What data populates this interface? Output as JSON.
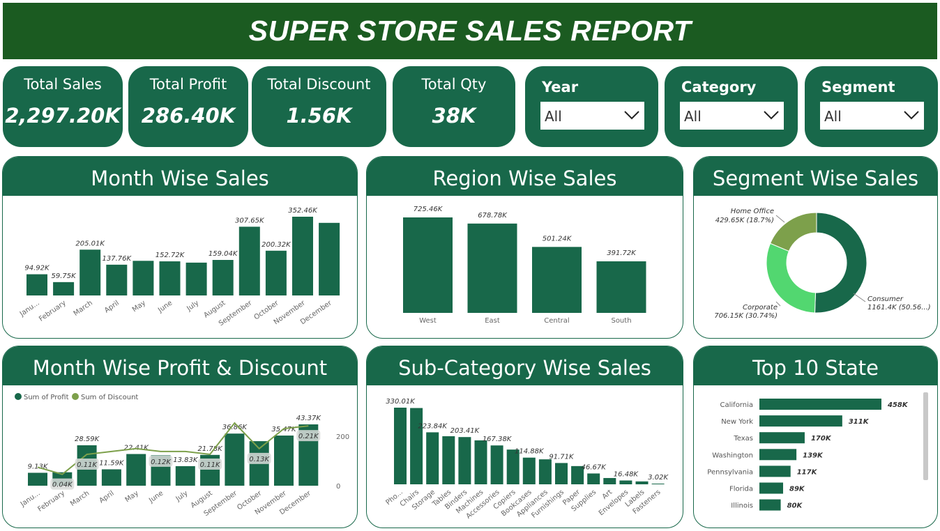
{
  "title": "SUPER STORE SALES REPORT",
  "colors": {
    "dark_green": "#1b5b21",
    "panel_green": "#18684a",
    "bar": "#18684a",
    "light_green": "#52d770",
    "olive": "#7da04b"
  },
  "kpis": [
    {
      "label": "Total Sales",
      "value": "2,297.20K"
    },
    {
      "label": "Total Profit",
      "value": "286.40K"
    },
    {
      "label": "Total Discount",
      "value": "1.56K"
    },
    {
      "label": "Total Qty",
      "value": "38K"
    }
  ],
  "slicers": [
    {
      "label": "Year",
      "value": "All"
    },
    {
      "label": "Category",
      "value": "All"
    },
    {
      "label": "Segment",
      "value": "All"
    }
  ],
  "panels": {
    "month_sales": "Month Wise Sales",
    "region_sales": "Region Wise Sales",
    "segment_sales": "Segment Wise Sales",
    "month_profit": "Month Wise Profit & Discount",
    "subcat_sales": "Sub-Category Wise Sales",
    "top_states": "Top 10 State"
  },
  "chart_data": [
    {
      "type": "bar",
      "id": "month_sales",
      "title": "Month Wise Sales",
      "categories": [
        "Janu...",
        "February",
        "March",
        "April",
        "May",
        "June",
        "July",
        "August",
        "September",
        "October",
        "November",
        "December"
      ],
      "values": [
        94.92,
        59.75,
        205.01,
        137.76,
        155,
        152.72,
        147,
        159.04,
        307.65,
        200.32,
        352.46,
        325
      ],
      "data_labels": [
        "94.92K",
        "59.75K",
        "205.01K",
        "137.76K",
        "",
        "152.72K",
        "",
        "159.04K",
        "307.65K",
        "200.32K",
        "352.46K",
        ""
      ]
    },
    {
      "type": "bar",
      "id": "region_sales",
      "title": "Region Wise Sales",
      "categories": [
        "West",
        "East",
        "Central",
        "South"
      ],
      "values": [
        725.46,
        678.78,
        501.24,
        391.72
      ],
      "data_labels": [
        "725.46K",
        "678.78K",
        "501.24K",
        "391.72K"
      ]
    },
    {
      "type": "pie",
      "id": "segment_sales",
      "title": "Segment Wise Sales",
      "categories": [
        "Consumer",
        "Corporate",
        "Home Office"
      ],
      "values": [
        1161.4,
        706.15,
        429.65
      ],
      "data_labels": [
        "1161.4K (50.56...)",
        "706.15K (30.74%)",
        "429.65K (18.7%)"
      ]
    },
    {
      "type": "bar",
      "id": "month_profit",
      "title": "Month Wise Profit & Discount",
      "categories": [
        "Janu...",
        "February",
        "March",
        "April",
        "May",
        "June",
        "July",
        "August",
        "September",
        "October",
        "November",
        "December"
      ],
      "legend": [
        "Sum of Profit",
        "Sum of Discount"
      ],
      "series": [
        {
          "name": "Sum of Profit",
          "values": [
            9.13,
            9.5,
            28.59,
            11.59,
            22.41,
            21.5,
            13.83,
            21.78,
            36.86,
            31.5,
            35.47,
            43.37
          ],
          "labels": [
            "9.13K",
            "",
            "28.59K",
            "11.59K",
            "22.41K",
            "",
            "13.83K",
            "21.78K",
            "36.86K",
            "",
            "35.47K",
            "43.37K"
          ]
        },
        {
          "name": "Sum of Discount",
          "values": [
            0.065,
            0.04,
            0.11,
            0.12,
            0.13,
            0.12,
            0.12,
            0.11,
            0.22,
            0.13,
            0.2,
            0.21
          ],
          "labels": [
            "",
            "0.04K",
            "0.11K",
            "",
            "",
            "0.12K",
            "",
            "0.11K",
            "",
            "0.13K",
            "",
            "0.21K"
          ]
        }
      ],
      "y2_ticks": [
        "200",
        "0"
      ]
    },
    {
      "type": "bar",
      "id": "subcat_sales",
      "title": "Sub-Category Wise Sales",
      "categories": [
        "Pho...",
        "Chairs",
        "Storage",
        "Tables",
        "Binders",
        "Machines",
        "Accessories",
        "Copiers",
        "Bookcases",
        "Appliances",
        "Furnishings",
        "Paper",
        "Supplies",
        "Art",
        "Envelopes",
        "Labels",
        "Fasteners"
      ],
      "values": [
        330.01,
        328.45,
        223.84,
        206.97,
        203.41,
        189.24,
        167.38,
        149.53,
        114.88,
        107.53,
        91.71,
        78.48,
        46.67,
        27.12,
        16.48,
        12.49,
        3.02
      ],
      "data_labels": [
        "330.01K",
        "",
        "223.84K",
        "",
        "203.41K",
        "",
        "167.38K",
        "",
        "114.88K",
        "",
        "91.71K",
        "",
        "46.67K",
        "",
        "16.48K",
        "",
        "3.02K"
      ]
    },
    {
      "type": "bar",
      "id": "top_states",
      "title": "Top 10 State",
      "orientation": "horizontal",
      "categories": [
        "California",
        "New York",
        "Texas",
        "Washington",
        "Pennsylvania",
        "Florida",
        "Illinois"
      ],
      "values": [
        458,
        311,
        170,
        139,
        117,
        89,
        80
      ],
      "data_labels": [
        "458K",
        "311K",
        "170K",
        "139K",
        "117K",
        "89K",
        "80K"
      ]
    }
  ]
}
